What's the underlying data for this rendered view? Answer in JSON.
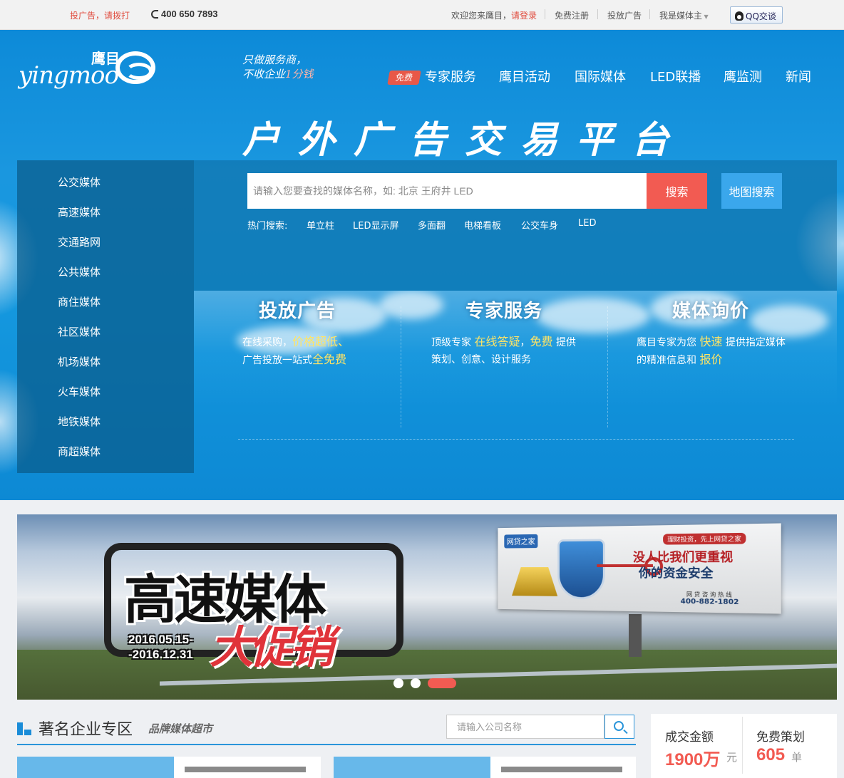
{
  "topbar": {
    "promo": "投广告，请拨打",
    "phone": "400 650 7893",
    "welcome": "欢迎您来鹰目，",
    "login": "请登录",
    "links": [
      "免费注册",
      "投放广告",
      "我是媒体主"
    ],
    "qq": "QQ交谈"
  },
  "header": {
    "logo_cn": "鹰目",
    "logo_en": "yingmoo",
    "slogan_line1": "只做服务商，",
    "slogan_line2": "不收企业",
    "slogan_line2_highlight": "1分钱",
    "free_badge": "免费",
    "nav": [
      "专家服务",
      "鹰目活动",
      "国际媒体",
      "LED联播",
      "鹰监测",
      "新闻"
    ],
    "big_title": "户外广告交易平台"
  },
  "categories": [
    "公交媒体",
    "高速媒体",
    "交通路网",
    "公共媒体",
    "商住媒体",
    "社区媒体",
    "机场媒体",
    "火车媒体",
    "地铁媒体",
    "商超媒体"
  ],
  "search": {
    "placeholder": "请输入您要查找的媒体名称，如: 北京 王府井 LED",
    "button": "搜索",
    "map_button": "地图搜索",
    "hot_label": "热门搜索:",
    "hot_terms": [
      "单立柱",
      "LED显示屏",
      "多面翻",
      "电梯看板",
      "公交车身",
      "LED"
    ]
  },
  "services": [
    {
      "title": "投放广告",
      "p1": "在线采购，",
      "h1": "价格超低、",
      "p2": "广告投放一站式",
      "h2": "全免费",
      "p3": ""
    },
    {
      "title": "专家服务",
      "p1": "顶级专家",
      "h1": "在线答疑",
      "p2": "，",
      "h2": "免费",
      "p3": "提供",
      "line2": "策划、创意、设计服务"
    },
    {
      "title": "媒体询价",
      "p1": "鹰目专家为您",
      "h1": "快速",
      "p2": "提供指定媒体",
      "line2a": "的精准信息和",
      "h2": "报价"
    }
  ],
  "banner": {
    "title1": "高速媒体",
    "title2": "大促销",
    "date1": "2016.05.15-",
    "date2": "-2016.12.31",
    "billboard_brand": "网贷之家",
    "billboard_tag": "理财投资，先上网贷之家",
    "billboard_line1": "没人比我们更重视",
    "billboard_line2": "你的资金安全",
    "billboard_hotline_label": "网 贷 咨 询 热 线",
    "billboard_phone": "400-882-1802",
    "active_slide": 3,
    "slide_count": 3
  },
  "enterprise": {
    "title": "著名企业专区",
    "subtitle": "品牌媒体超市",
    "search_placeholder": "请输入公司名称"
  },
  "stats": {
    "deal_label": "成交金额",
    "deal_value": "1900万",
    "deal_unit": "元",
    "plan_label": "免费策划",
    "plan_value": "605",
    "plan_unit": "单"
  },
  "colors": {
    "accent_red": "#f25b52",
    "brand_blue": "#1a97df",
    "highlight_yellow": "#ffe466"
  }
}
